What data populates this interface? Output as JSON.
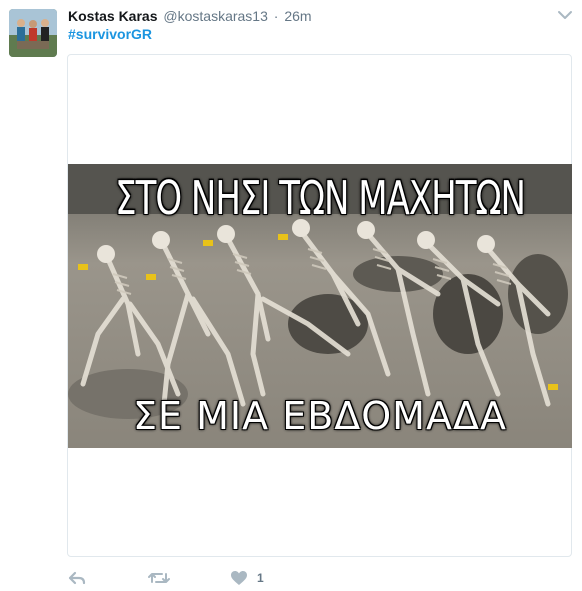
{
  "tweet": {
    "author": {
      "fullname": "Kostas Karas",
      "username": "@kostaskaras13",
      "separator": "·",
      "time": "26m"
    },
    "hashtag": "#survivorGR",
    "media": {
      "caption_top": "ΣΤΟ ΝΗΣΙ ΤΩΝ ΜΑΧΗΤΩΝ",
      "caption_bottom": "ΣΕ ΜΙΑ ΕΒΔΟΜΑΔΑ"
    },
    "actions": {
      "like_count": "1"
    }
  },
  "colors": {
    "link": "#1b95e0",
    "secondary_text": "#657786",
    "icon": "#aab8c2",
    "border": "#e1e8ed"
  },
  "icons": [
    "avatar",
    "chevron-down-icon",
    "reply-icon",
    "retweet-icon",
    "heart-icon"
  ]
}
